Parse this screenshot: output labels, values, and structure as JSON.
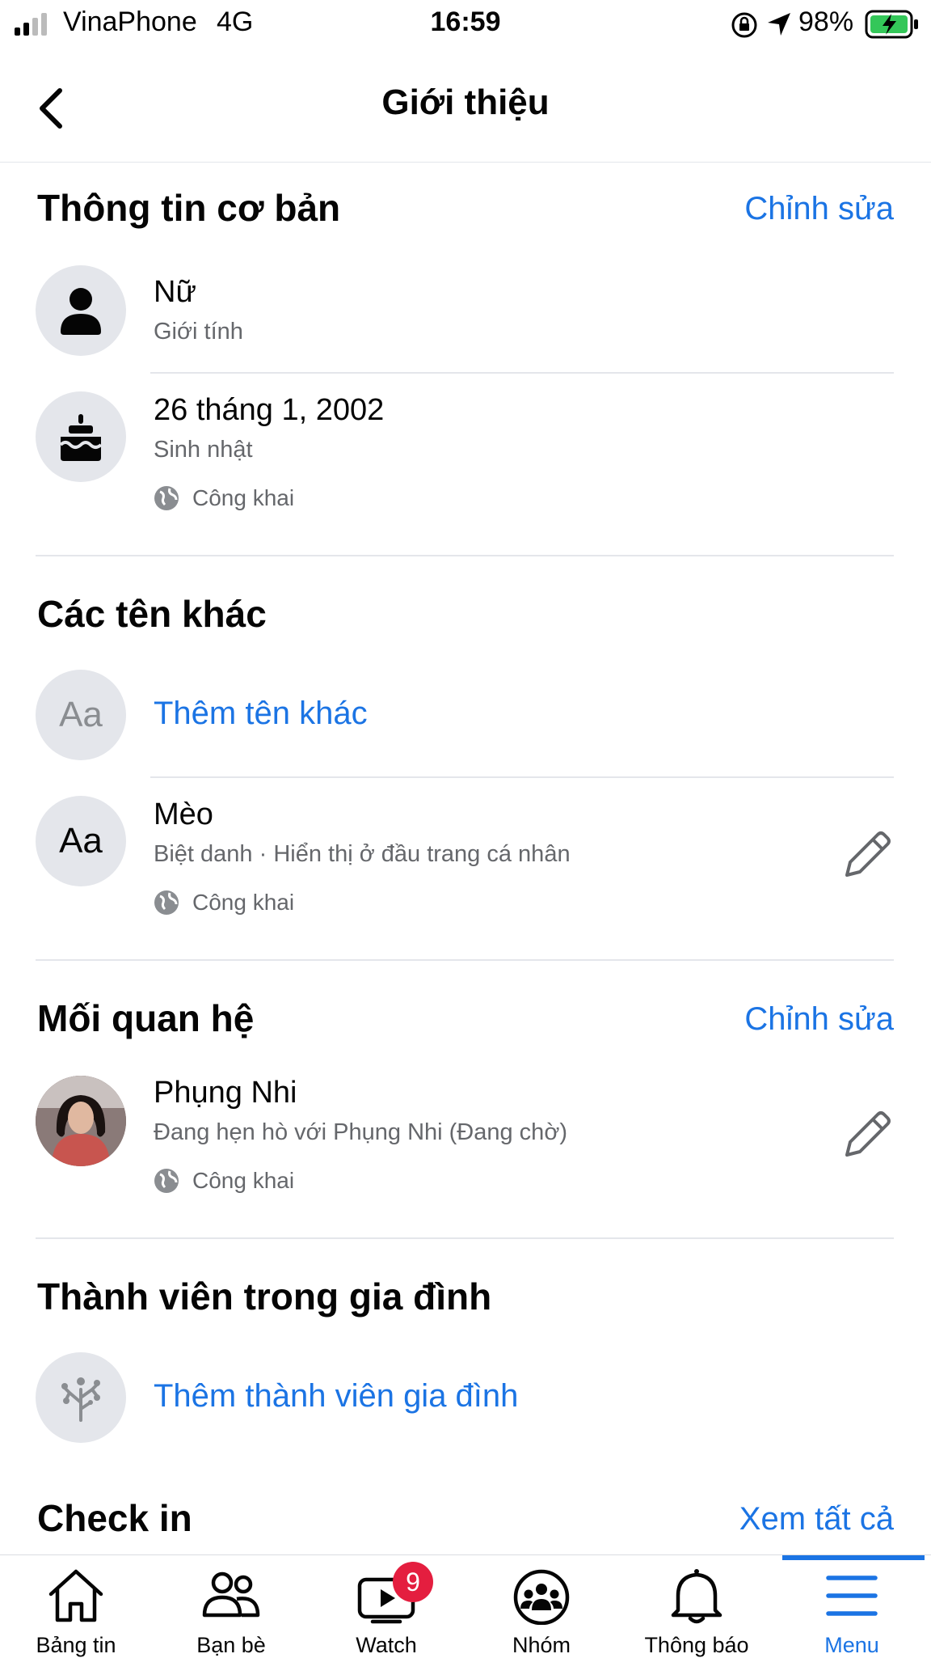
{
  "status_bar": {
    "carrier": "VinaPhone",
    "network": "4G",
    "time": "16:59",
    "battery": "98%"
  },
  "header": {
    "title": "Giới thiệu"
  },
  "basic_info": {
    "title": "Thông tin cơ bản",
    "edit_label": "Chỉnh sửa",
    "gender": {
      "value": "Nữ",
      "label": "Giới tính"
    },
    "birthday": {
      "value": "26 tháng 1, 2002",
      "label": "Sinh nhật",
      "privacy": "Công khai"
    }
  },
  "other_names": {
    "title": "Các tên khác",
    "add_label": "Thêm tên khác",
    "add_icon_text": "Aa",
    "item": {
      "icon_text": "Aa",
      "value": "Mèo",
      "label": "Biệt danh · Hiển thị ở đầu trang cá nhân",
      "privacy": "Công khai"
    }
  },
  "relationship": {
    "title": "Mối quan hệ",
    "edit_label": "Chỉnh sửa",
    "name": "Phụng Nhi",
    "status": "Đang hẹn hò với Phụng Nhi (Đang chờ)",
    "privacy": "Công khai"
  },
  "family": {
    "title": "Thành viên trong gia đình",
    "add_label": "Thêm thành viên gia đình"
  },
  "checkin": {
    "title": "Check in",
    "see_all_label": "Xem tất cả"
  },
  "bottom_nav": {
    "items": [
      {
        "label": "Bảng tin",
        "icon": "home-icon"
      },
      {
        "label": "Bạn bè",
        "icon": "friends-icon"
      },
      {
        "label": "Watch",
        "icon": "watch-icon",
        "badge": "9"
      },
      {
        "label": "Nhóm",
        "icon": "groups-icon"
      },
      {
        "label": "Thông báo",
        "icon": "bell-icon"
      },
      {
        "label": "Menu",
        "icon": "menu-icon",
        "active": true
      }
    ]
  },
  "colors": {
    "accent": "#1b74e4",
    "badge": "#e41e3f",
    "secondary_text": "#65676b",
    "circle_bg": "#e4e6eb"
  }
}
